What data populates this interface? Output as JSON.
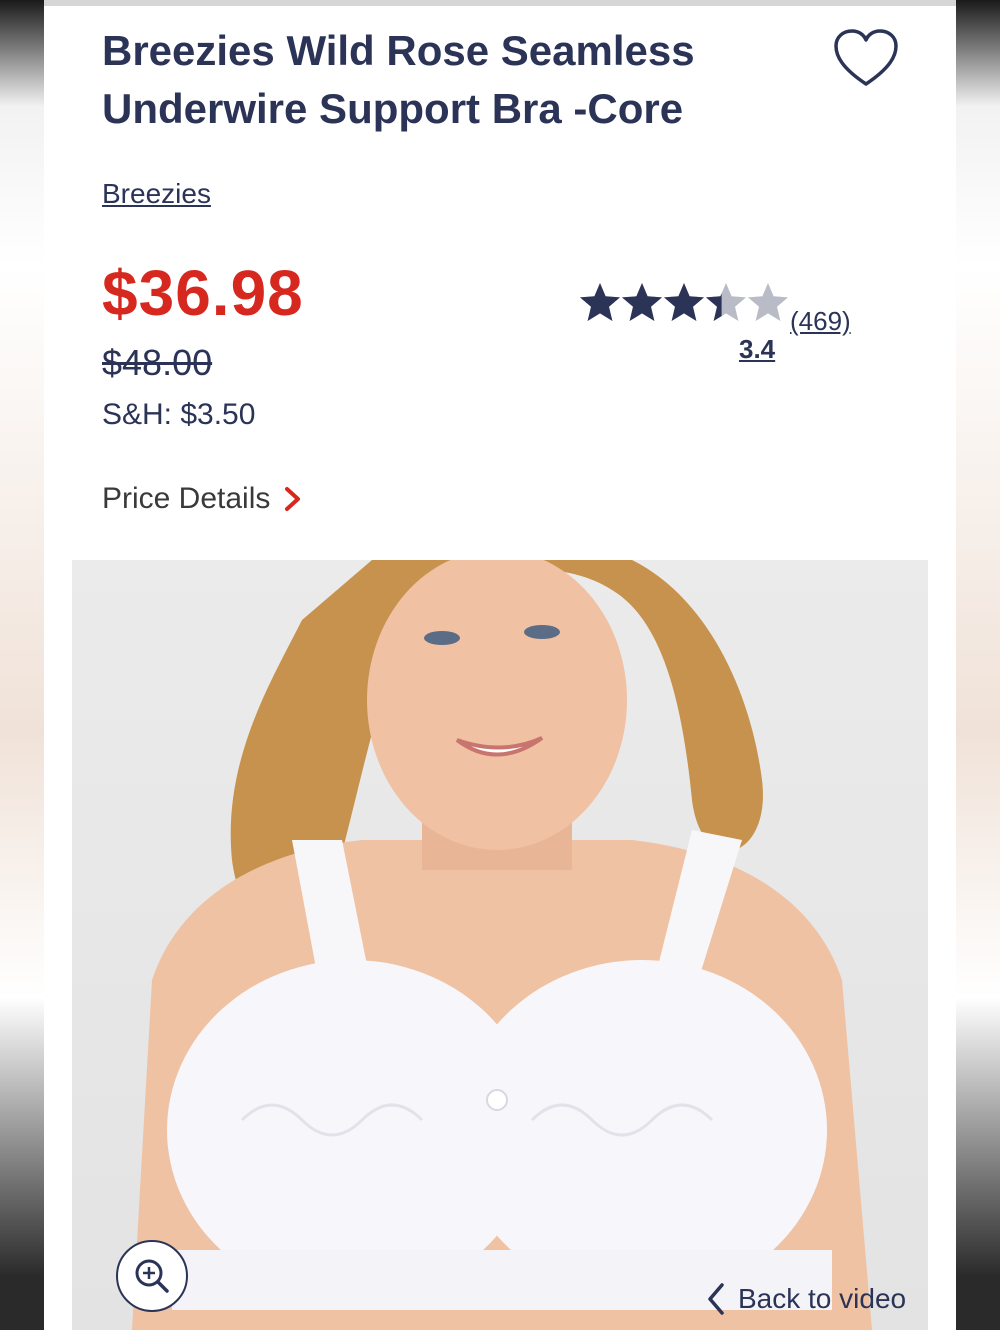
{
  "product": {
    "title": "Breezies Wild Rose Seamless Underwire Support Bra -Core",
    "brand": "Breezies",
    "price": "$36.98",
    "was_price": "$48.00",
    "shipping": "S&H: $3.50",
    "price_details_label": "Price Details"
  },
  "rating": {
    "value": "3.4",
    "review_count": "(469)",
    "stars_total": 5,
    "stars_filled": 3.4
  },
  "gallery": {
    "back_to_video_label": "Back to video"
  },
  "colors": {
    "navy": "#2b3457",
    "sale_red": "#d6281e",
    "star_empty": "#b9bcc6"
  },
  "icons": {
    "wishlist": "heart-icon",
    "zoom": "zoom-in-icon",
    "chevron": "chevron-right-icon",
    "back": "chevron-left-icon"
  }
}
